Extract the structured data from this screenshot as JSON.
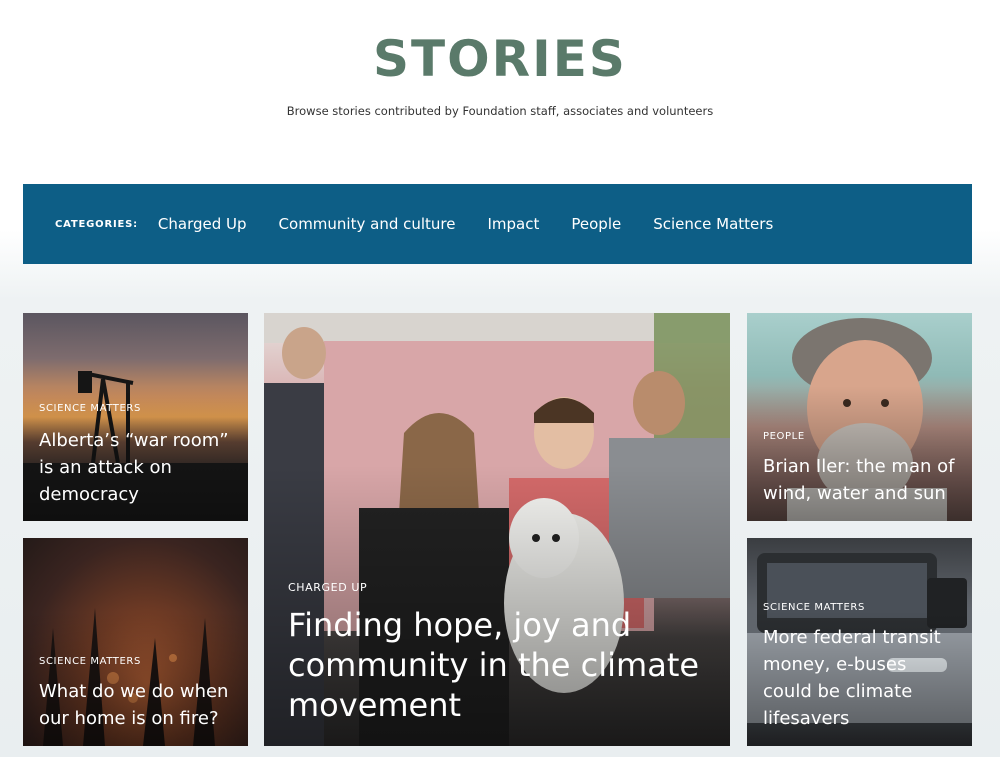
{
  "header": {
    "title": "STORIES",
    "subtitle": "Browse stories contributed by Foundation staff, associates and volunteers"
  },
  "categories": {
    "label": "CATEGORIES:",
    "items": [
      "Charged Up",
      "Community and culture",
      "Impact",
      "People",
      "Science Matters"
    ]
  },
  "cards": [
    {
      "category": "SCIENCE MATTERS",
      "title": "Alberta’s “war room” is an attack on democracy"
    },
    {
      "category": "SCIENCE MATTERS",
      "title": "What do we do when our home is on fire?"
    },
    {
      "category": "CHARGED UP",
      "title": "Finding hope, joy and community in the climate movement"
    },
    {
      "category": "PEOPLE",
      "title": "Brian Iler: the man of wind, water and sun"
    },
    {
      "category": "SCIENCE MATTERS",
      "title": "More federal transit money, e-buses could be climate lifesavers"
    }
  ],
  "colors": {
    "title": "#5a7a6a",
    "category_bar": "#0d5e86"
  }
}
